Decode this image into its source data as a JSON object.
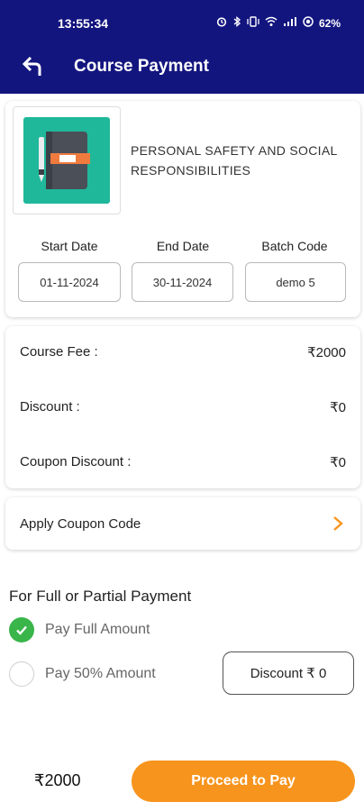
{
  "status_bar": {
    "time": "13:55:34",
    "icons": [
      "alarm-icon",
      "bluetooth-icon",
      "vibrate-icon",
      "wifi-icon",
      "signal-icon"
    ],
    "battery": "62%"
  },
  "header": {
    "title": "Course Payment",
    "bg_color": "#13157f"
  },
  "course": {
    "name": "PERSONAL SAFETY AND SOCIAL RESPONSIBILITIES",
    "thumbnail_color": "#1fb89a",
    "start_date_label": "Start Date",
    "start_date": "01-11-2024",
    "end_date_label": "End Date",
    "end_date": "30-11-2024",
    "batch_code_label": "Batch Code",
    "batch_code": "demo 5"
  },
  "fees": {
    "course_fee_label": "Course Fee :",
    "course_fee": "₹2000",
    "discount_label": "Discount :",
    "discount": "₹0",
    "coupon_discount_label": "Coupon Discount :",
    "coupon_discount": "₹0"
  },
  "coupon": {
    "label": "Apply Coupon Code",
    "accent_color": "#f7941d"
  },
  "payment_options": {
    "title": "For Full or Partial Payment",
    "full_label": "Pay Full Amount",
    "full_selected": true,
    "partial_label": "Pay 50% Amount",
    "partial_selected": false,
    "discount_button": "Discount ₹ 0",
    "selected_color": "#39b54a"
  },
  "footer": {
    "total": "₹2000",
    "proceed_label": "Proceed to Pay",
    "button_color": "#f7941d"
  }
}
